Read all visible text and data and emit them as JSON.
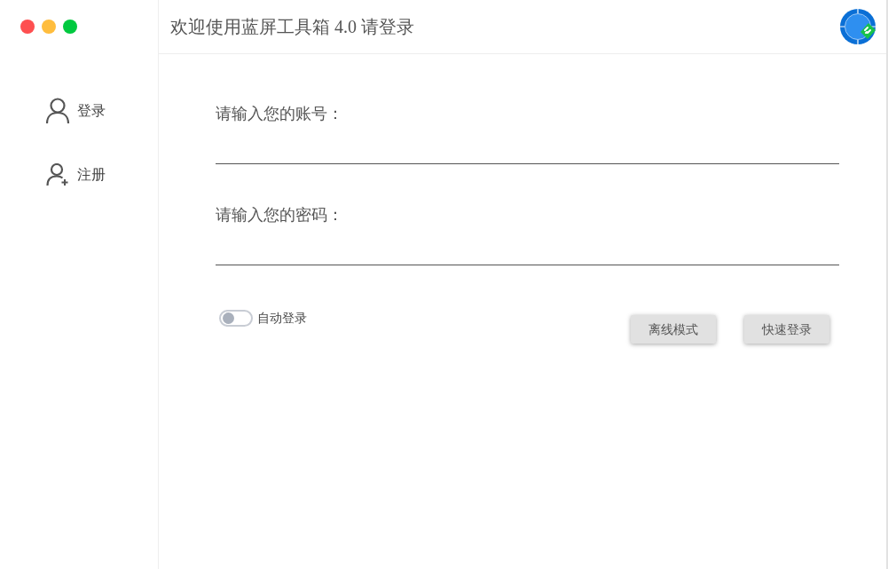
{
  "window": {
    "title": "欢迎使用蓝屏工具箱 4.0 请登录"
  },
  "sidebar": {
    "items": [
      {
        "label": "登录",
        "kind": "user"
      },
      {
        "label": "注册",
        "kind": "add-user"
      }
    ]
  },
  "form": {
    "fields": [
      {
        "label": "请输入您的账号："
      },
      {
        "label": "请输入您的密码："
      }
    ]
  },
  "auto_login": {
    "label": "自动登录",
    "on": false
  },
  "buttons": [
    {
      "label": "离线模式"
    },
    {
      "label": "快速登录"
    }
  ]
}
